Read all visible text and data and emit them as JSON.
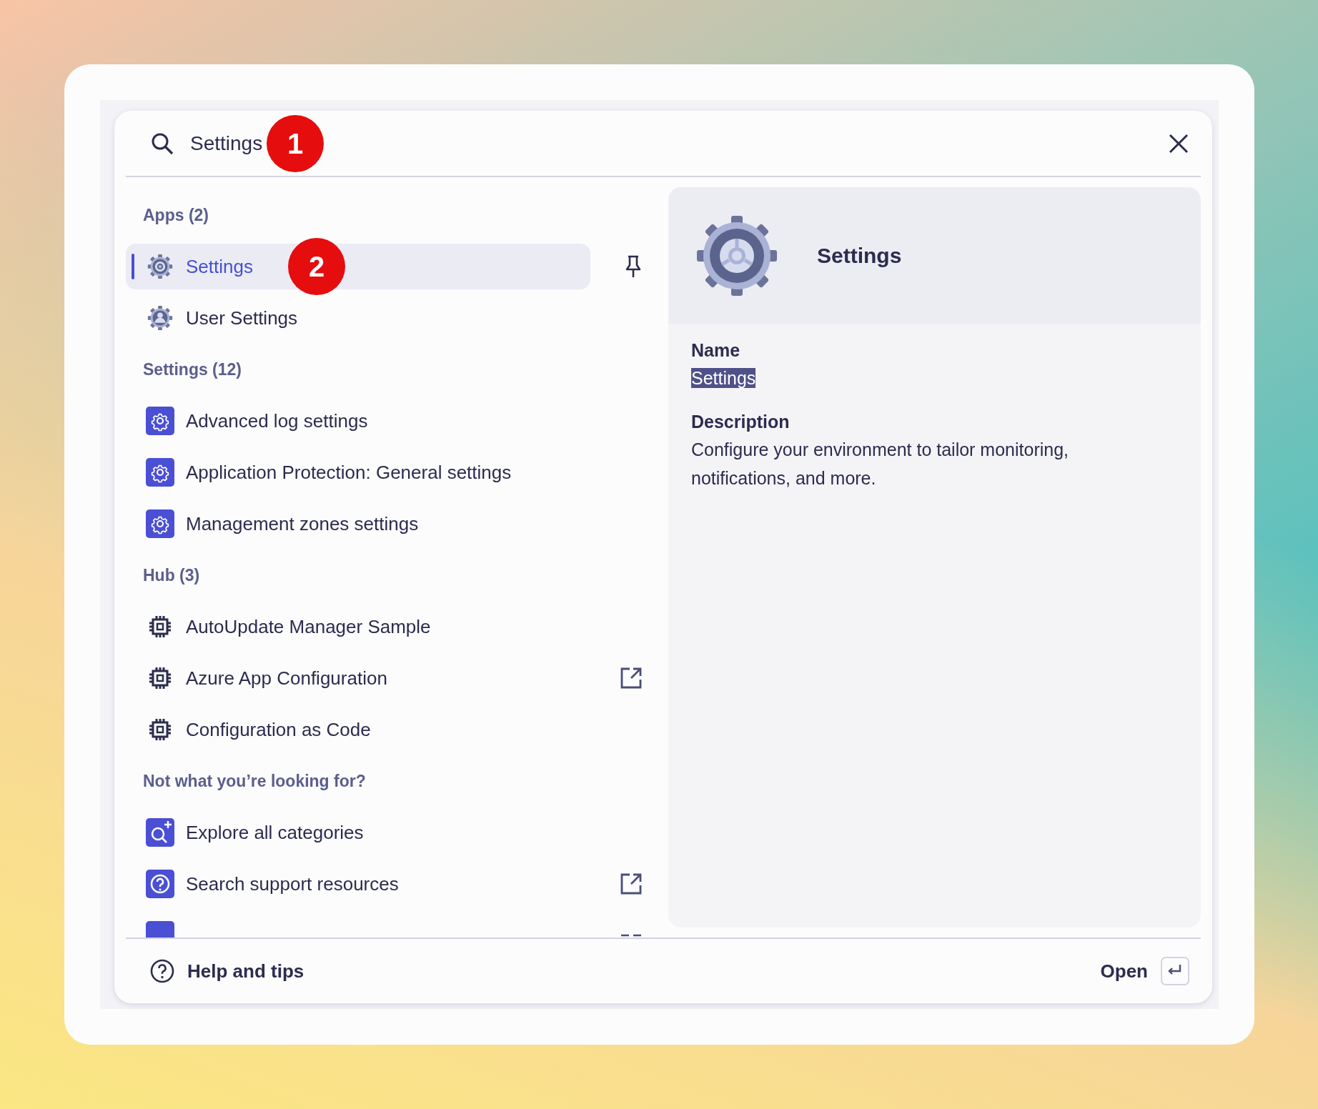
{
  "search": {
    "value": "Settings",
    "callout": "1"
  },
  "sections": [
    {
      "title": "Apps (2)",
      "items": [
        {
          "label": "Settings",
          "kind": "app",
          "selected": true,
          "pinned": true,
          "callout": "2"
        },
        {
          "label": "User Settings",
          "kind": "user-app",
          "selected": false,
          "pinned": false
        }
      ]
    },
    {
      "title": "Settings (12)",
      "items": [
        {
          "label": "Advanced log settings",
          "kind": "setting",
          "selected": false
        },
        {
          "label": "Application Protection: General settings",
          "kind": "setting",
          "selected": false
        },
        {
          "label": "Management zones settings",
          "kind": "setting",
          "selected": false
        }
      ]
    },
    {
      "title": "Hub (3)",
      "items": [
        {
          "label": "AutoUpdate Manager Sample",
          "kind": "hub",
          "selected": false,
          "external": false
        },
        {
          "label": "Azure App Configuration",
          "kind": "hub",
          "selected": false,
          "external": true
        },
        {
          "label": "Configuration as Code",
          "kind": "hub",
          "selected": false,
          "external": false
        }
      ]
    },
    {
      "title": "Not what you’re looking for?",
      "items": [
        {
          "label": "Explore all categories",
          "kind": "explore",
          "selected": false,
          "external": false
        },
        {
          "label": "Search support resources",
          "kind": "support",
          "selected": false,
          "external": true
        },
        {
          "kind": "partial",
          "selected": false
        }
      ]
    }
  ],
  "preview": {
    "title": "Settings",
    "fields": [
      {
        "label": "Name",
        "value": "Settings",
        "highlighted": true
      },
      {
        "label": "Description",
        "value": "Configure your environment to tailor monitoring, notifications, and more.",
        "highlighted": false
      }
    ]
  },
  "footer": {
    "help": "Help and tips",
    "action": "Open"
  }
}
